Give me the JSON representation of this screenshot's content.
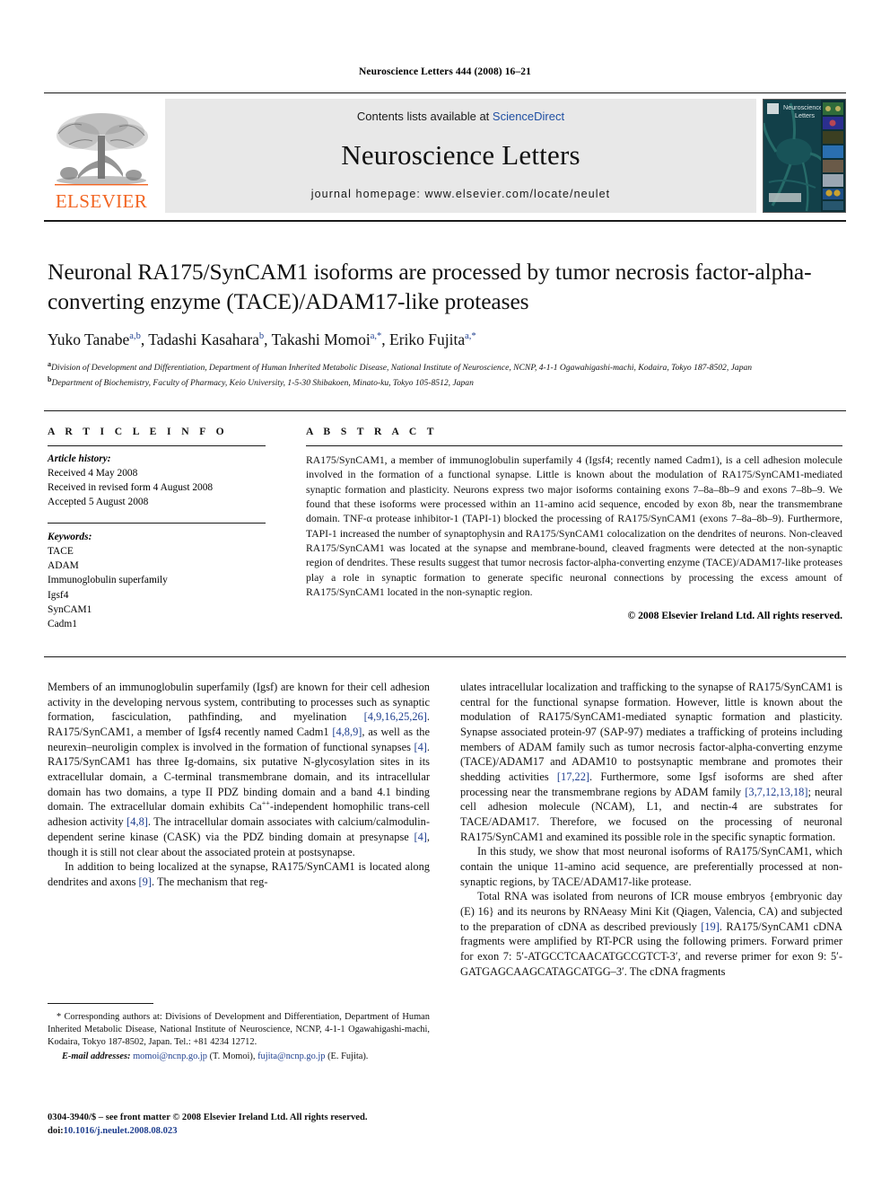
{
  "running_head": "Neuroscience Letters 444 (2008) 16–21",
  "masthead": {
    "publisher_name": "ELSEVIER",
    "contents_prefix": "Contents lists available at ",
    "contents_link": "ScienceDirect",
    "journal_title": "Neuroscience Letters",
    "homepage": "journal homepage: www.elsevier.com/locate/neulet",
    "cover_title_line1": "Neuroscience",
    "cover_title_line2": "Letters"
  },
  "article": {
    "title": "Neuronal RA175/SynCAM1 isoforms are processed by tumor necrosis factor-alpha-converting enzyme (TACE)/ADAM17-like proteases",
    "authors": [
      {
        "name": "Yuko Tanabe",
        "marks": "a,b",
        "sep": ", "
      },
      {
        "name": "Tadashi Kasahara",
        "marks": "b",
        "sep": ", "
      },
      {
        "name": "Takashi Momoi",
        "marks": "a,*",
        "sep": ", "
      },
      {
        "name": "Eriko Fujita",
        "marks": "a,*",
        "sep": ""
      }
    ],
    "affiliations": [
      {
        "mark": "a",
        "text": "Division of Development and Differentiation, Department of Human Inherited Metabolic Disease, National Institute of Neuroscience, NCNP, 4-1-1 Ogawahigashi-machi, Kodaira, Tokyo 187-8502, Japan"
      },
      {
        "mark": "b",
        "text": "Department of Biochemistry, Faculty of Pharmacy, Keio University, 1-5-30 Shibakoen, Minato-ku, Tokyo 105-8512, Japan"
      }
    ]
  },
  "article_info": {
    "heading": "A R T I C L E   I N F O",
    "history_label": "Article history:",
    "history": [
      "Received 4 May 2008",
      "Received in revised form 4 August 2008",
      "Accepted 5 August 2008"
    ],
    "keywords_label": "Keywords:",
    "keywords": [
      "TACE",
      "ADAM",
      "Immunoglobulin superfamily",
      "Igsf4",
      "SynCAM1",
      "Cadm1"
    ]
  },
  "abstract": {
    "heading": "A B S T R A C T",
    "text": "RA175/SynCAM1, a member of immunoglobulin superfamily 4 (Igsf4; recently named Cadm1), is a cell adhesion molecule involved in the formation of a functional synapse. Little is known about the modulation of RA175/SynCAM1-mediated synaptic formation and plasticity. Neurons express two major isoforms containing exons 7–8a–8b–9 and exons 7–8b–9. We found that these isoforms were processed within an 11-amino acid sequence, encoded by exon 8b, near the transmembrane domain. TNF-α protease inhibitor-1 (TAPI-1) blocked the processing of RA175/SynCAM1 (exons 7–8a–8b–9). Furthermore, TAPI-1 increased the number of synaptophysin and RA175/SynCAM1 colocalization on the dendrites of neurons. Non-cleaved RA175/SynCAM1 was located at the synapse and membrane-bound, cleaved fragments were detected at the non-synaptic region of dendrites. These results suggest that tumor necrosis factor-alpha-converting enzyme (TACE)/ADAM17-like proteases play a role in synaptic formation to generate specific neuronal connections by processing the excess amount of RA175/SynCAM1 located in the non-synaptic region.",
    "copyright": "© 2008 Elsevier Ireland Ltd. All rights reserved."
  },
  "body": {
    "left_column": [
      {
        "indent": false,
        "segments": [
          {
            "t": "Members of an immunoglobulin superfamily (Igsf) are known for their cell adhesion activity in the developing nervous system, contributing to processes such as synaptic formation, fasciculation, pathfinding, and myelination "
          },
          {
            "t": "[4,9,16,25,26]",
            "ref": true
          },
          {
            "t": ". RA175/SynCAM1, a member of Igsf4 recently named Cadm1 "
          },
          {
            "t": "[4,8,9]",
            "ref": true
          },
          {
            "t": ", as well as the neurexin–neuroligin complex is involved in the formation of functional synapses "
          },
          {
            "t": "[4]",
            "ref": true
          },
          {
            "t": ". RA175/SynCAM1 has three Ig-domains, six putative N-glycosylation sites in its extracellular domain, a C-terminal transmembrane domain, and its intracellular domain has two domains, a type II PDZ binding domain and a band 4.1 binding domain. The extracellular domain exhibits Ca"
          },
          {
            "t": "++",
            "sup": true
          },
          {
            "t": "-independent homophilic trans-cell adhesion activity "
          },
          {
            "t": "[4,8]",
            "ref": true
          },
          {
            "t": ". The intracellular domain associates with calcium/calmodulin-dependent serine kinase (CASK) via the PDZ binding domain at presynapse "
          },
          {
            "t": "[4]",
            "ref": true
          },
          {
            "t": ", though it is still not clear about the associated protein at postsynapse."
          }
        ]
      },
      {
        "indent": true,
        "segments": [
          {
            "t": "In addition to being localized at the synapse, RA175/SynCAM1 is located along dendrites and axons "
          },
          {
            "t": "[9]",
            "ref": true
          },
          {
            "t": ". The mechanism that reg-"
          }
        ]
      }
    ],
    "right_column": [
      {
        "indent": false,
        "segments": [
          {
            "t": "ulates intracellular localization and trafficking to the synapse of RA175/SynCAM1 is central for the functional synapse formation. However, little is known about the modulation of RA175/SynCAM1-mediated synaptic formation and plasticity. Synapse associated protein-97 (SAP-97) mediates a trafficking of proteins including members of ADAM family such as tumor necrosis factor-alpha-converting enzyme (TACE)/ADAM17 and ADAM10 to postsynaptic membrane and promotes their shedding activities "
          },
          {
            "t": "[17,22]",
            "ref": true
          },
          {
            "t": ". Furthermore, some Igsf isoforms are shed after processing near the transmembrane regions by ADAM family "
          },
          {
            "t": "[3,7,12,13,18]",
            "ref": true
          },
          {
            "t": "; neural cell adhesion molecule (NCAM), L1, and nectin-4 are substrates for TACE/ADAM17. Therefore, we focused on the processing of neuronal RA175/SynCAM1 and examined its possible role in the specific synaptic formation."
          }
        ]
      },
      {
        "indent": true,
        "segments": [
          {
            "t": "In this study, we show that most neuronal isoforms of RA175/SynCAM1, which contain the unique 11-amino acid sequence, are preferentially processed at non-synaptic regions, by TACE/ADAM17-like protease."
          }
        ]
      },
      {
        "indent": true,
        "segments": [
          {
            "t": "Total RNA was isolated from neurons of ICR mouse embryos {embryonic day (E) 16} and its neurons by RNAeasy Mini Kit (Qiagen, Valencia, CA) and subjected to the preparation of cDNA as described previously "
          },
          {
            "t": "[19]",
            "ref": true
          },
          {
            "t": ". RA175/SynCAM1 cDNA fragments were amplified by RT-PCR using the following primers. Forward primer for exon 7: 5′-ATGCCTCAACATGCCGTCT-3′, and reverse primer for exon 9: 5′-GATGAGCAAGCATAGCATGG–3′. The cDNA fragments"
          }
        ]
      }
    ]
  },
  "footnote": {
    "corresponding": "* Corresponding authors at: Divisions of Development and Differentiation, Department of Human Inherited Metabolic Disease, National Institute of Neuroscience, NCNP, 4-1-1 Ogawahigashi-machi, Kodaira, Tokyo 187-8502, Japan. Tel.: +81 4234 12712.",
    "email_label": "E-mail addresses:",
    "email_1": "momoi@ncnp.go.jp",
    "email_1_owner": "(T. Momoi)",
    "email_2": "fujita@ncnp.go.jp",
    "email_2_owner": "(E. Fujita)."
  },
  "imprint": {
    "line1": "0304-3940/$ – see front matter © 2008 Elsevier Ireland Ltd. All rights reserved.",
    "doi_label": "doi:",
    "doi_value": "10.1016/j.neulet.2008.08.023"
  },
  "colors": {
    "elsevier_orange": "#f26522",
    "link_blue": "#1f3f8f",
    "sciencedirect_blue": "#1f4fa3",
    "band_gray": "#e8e8e8"
  }
}
